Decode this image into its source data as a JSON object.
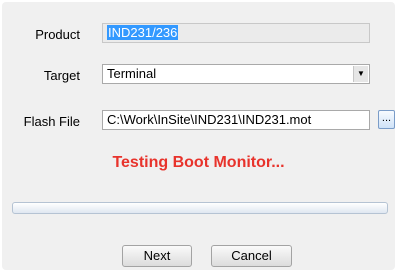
{
  "form": {
    "product_label": "Product",
    "product_value": "IND231/236",
    "target_label": "Target",
    "target_value": "Terminal",
    "flash_label": "Flash File",
    "flash_value": "C:\\Work\\InSite\\IND231\\IND231.mot",
    "browse_label": "..."
  },
  "status": {
    "text": "Testing Boot Monitor...",
    "color": "#e8332c"
  },
  "progress": {
    "value": 0
  },
  "buttons": {
    "next_label": "Next",
    "cancel_label": "Cancel"
  },
  "icons": {
    "dropdown_arrow": "chevron-down-icon"
  }
}
